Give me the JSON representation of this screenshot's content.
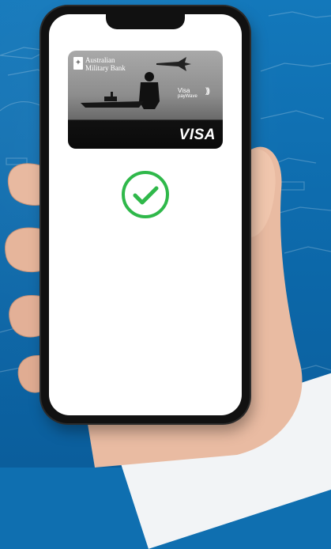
{
  "card": {
    "bank_name": "Australian\nMilitary Bank",
    "contactless_brand": "Visa",
    "contactless_label": "payWave",
    "network": "VISA"
  },
  "status": {
    "icon": "checkmark-circle-icon",
    "color": "#2fb84a"
  },
  "colors": {
    "background": "#0f6fb0",
    "screen": "#ffffff",
    "phone_frame": "#111111"
  }
}
